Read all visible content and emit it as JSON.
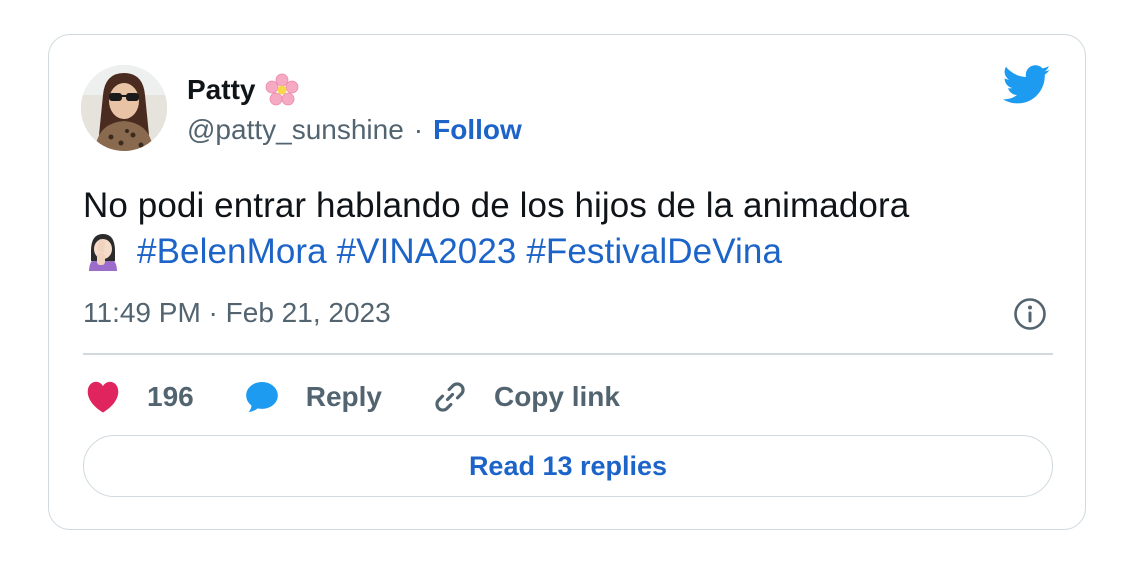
{
  "author": {
    "display_name": "Patty",
    "name_emoji_icon": "cherry-blossom-icon",
    "handle": "@patty_sunshine",
    "separator": "·",
    "follow_label": "Follow"
  },
  "brand": {
    "icon": "twitter-bird-icon",
    "color": "#1d9bf0"
  },
  "tweet": {
    "line1": "No podi entrar hablando de los hijos de la animadora",
    "emoji_icon": "woman-facepalming-icon",
    "hashtags": [
      "#BelenMora",
      "#VINA2023",
      "#FestivalDeVina"
    ],
    "timestamp": "11:49 PM · Feb 21, 2023"
  },
  "actions": {
    "like_count": "196",
    "reply_label": "Reply",
    "copy_link_label": "Copy link",
    "read_replies_label": "Read 13 replies"
  },
  "colors": {
    "link": "#1d64c9",
    "muted": "#536471",
    "like": "#e0245e",
    "reply": "#1d9bf0",
    "border": "#cfd9de"
  }
}
